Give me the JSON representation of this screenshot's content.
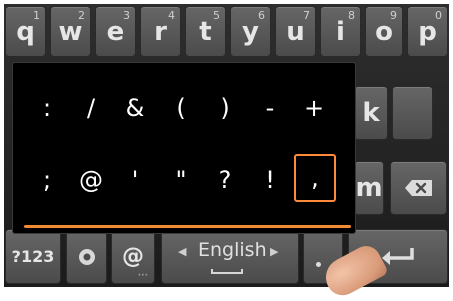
{
  "top_row": [
    {
      "label": "q",
      "hint": "1"
    },
    {
      "label": "w",
      "hint": "2"
    },
    {
      "label": "e",
      "hint": "3"
    },
    {
      "label": "r",
      "hint": "4"
    },
    {
      "label": "t",
      "hint": "5"
    },
    {
      "label": "y",
      "hint": "6"
    },
    {
      "label": "u",
      "hint": "7"
    },
    {
      "label": "i",
      "hint": "8"
    },
    {
      "label": "o",
      "hint": "9"
    },
    {
      "label": "p",
      "hint": "0"
    }
  ],
  "visible_keys": {
    "k": "k",
    "m": "m"
  },
  "popup": {
    "row1": [
      ":",
      "/",
      "&",
      "(",
      ")",
      "-",
      "+"
    ],
    "row2": [
      ";",
      "@",
      "'",
      "\"",
      "?",
      "!",
      ","
    ],
    "selected": ","
  },
  "bottom_row": {
    "symbols_label": "?123",
    "at_label": "@",
    "language": "English",
    "lang_left_arrow": "◀",
    "lang_right_arrow": "▶",
    "period_label": ".",
    "enter_icon": "enter-icon",
    "mic_icon": "settings-icon",
    "backspace_icon": "backspace-icon"
  },
  "colors": {
    "accent": "#f08a33",
    "key": "#585858",
    "bg": "#1f1f1f"
  }
}
